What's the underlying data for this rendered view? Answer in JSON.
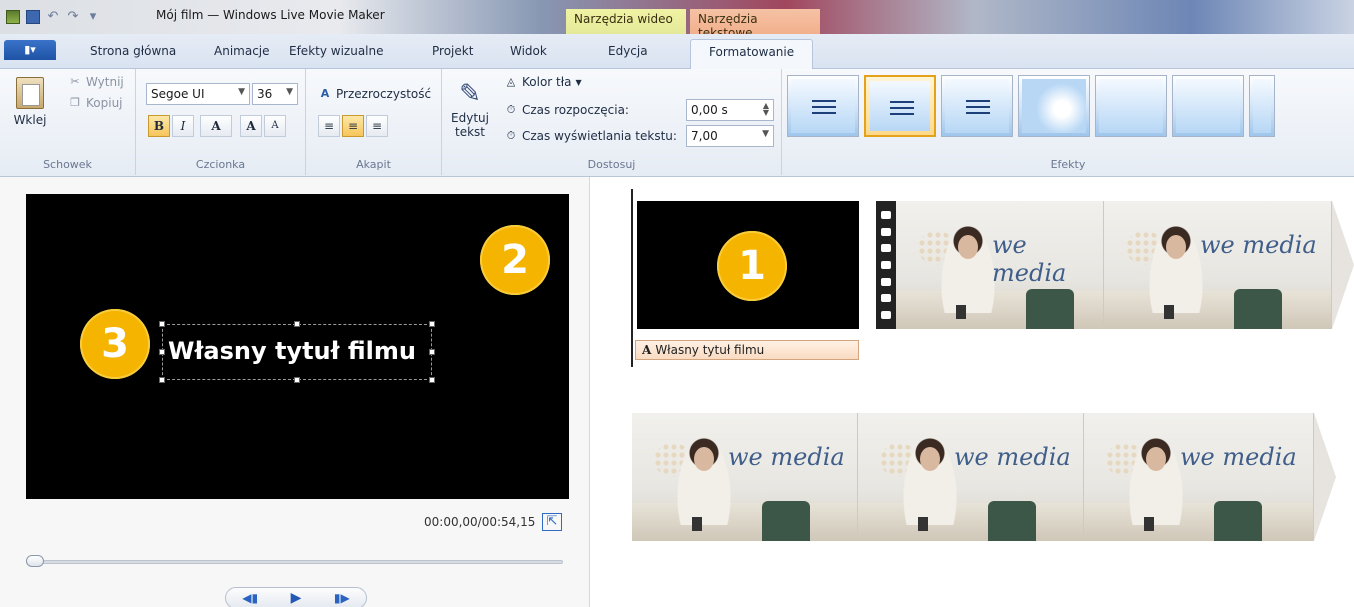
{
  "window": {
    "title": "Mój film — Windows Live Movie Maker",
    "context_tabs": {
      "video": "Narzędzia wideo",
      "text": "Narzędzia tekstowe"
    }
  },
  "tabs": {
    "file_label": "▮▾",
    "items": [
      {
        "label": "Strona główna"
      },
      {
        "label": "Animacje"
      },
      {
        "label": "Efekty wizualne"
      },
      {
        "label": "Projekt"
      },
      {
        "label": "Widok"
      },
      {
        "label": "Edycja"
      },
      {
        "label": "Formatowanie"
      }
    ],
    "active": "Formatowanie"
  },
  "ribbon": {
    "clipboard": {
      "label": "Schowek",
      "paste": "Wklej",
      "cut": "Wytnij",
      "copy": "Kopiuj"
    },
    "font": {
      "label": "Czcionka",
      "family": "Segoe UI",
      "size": "36",
      "bold": "B",
      "italic": "I",
      "color": "A",
      "grow": "A",
      "shrink": "A"
    },
    "paragraph": {
      "label": "Akapit",
      "transparency": "Przezroczystość"
    },
    "adjust": {
      "label": "Dostosuj",
      "edit_text_line1": "Edytuj",
      "edit_text_line2": "tekst",
      "bg_color": "Kolor tła",
      "start_time_label": "Czas rozpoczęcia:",
      "start_time_value": "0,00 s",
      "duration_label": "Czas wyświetlania tekstu:",
      "duration_value": "7,00"
    },
    "effects": {
      "label": "Efekty"
    }
  },
  "preview": {
    "title_text": "Własny tytuł filmu",
    "timecode": "00:00,00/00:54,15",
    "progress": 0.0
  },
  "timeline": {
    "caption": "Własny tytuł filmu",
    "logo_text": "we media"
  },
  "badges": {
    "one": "1",
    "two": "2",
    "three": "3"
  },
  "colors": {
    "badge": "#f4b400",
    "active_effect": "#e3a21a",
    "caption_bg": "#f9dbc1"
  }
}
